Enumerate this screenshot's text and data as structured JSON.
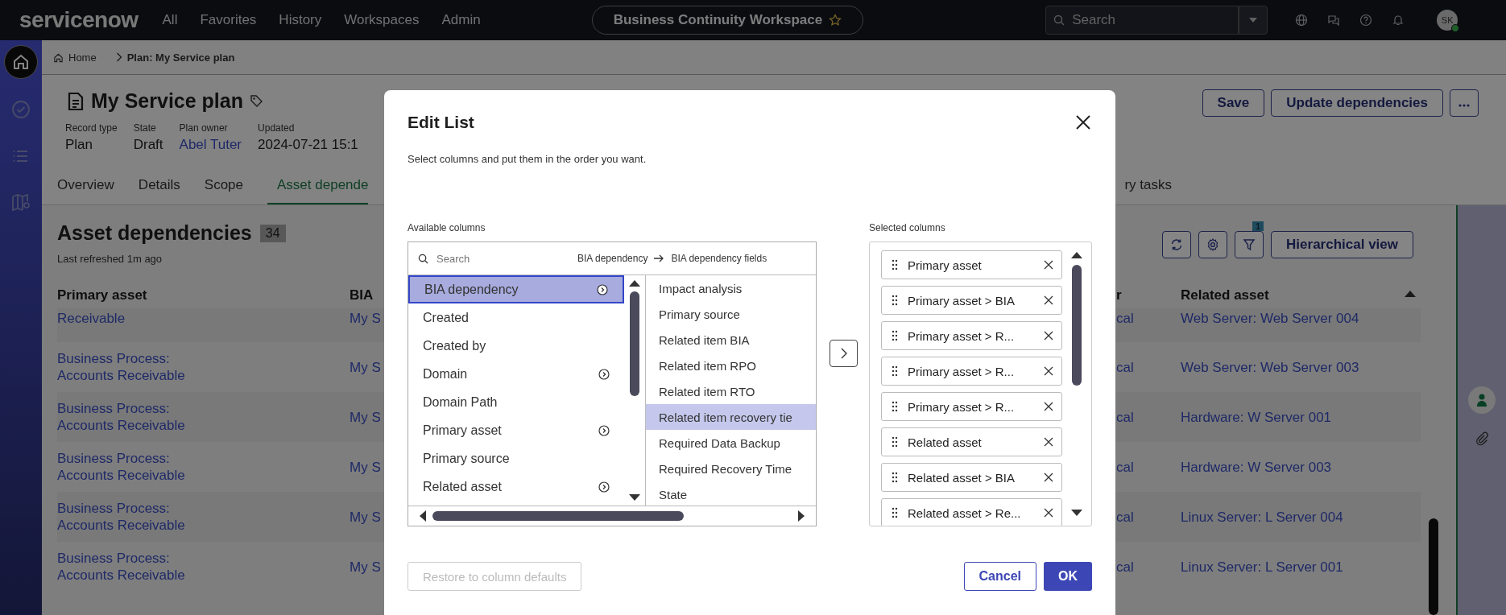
{
  "top_bar": {
    "logo": "servicenow",
    "nav": [
      "All",
      "Favorites",
      "History",
      "Workspaces",
      "Admin"
    ],
    "workspace": "Business Continuity Workspace",
    "search": {
      "placeholder": "Search"
    },
    "avatar": "SK"
  },
  "rail": [
    {
      "kind": "home",
      "selected": true
    },
    {
      "kind": "check",
      "selected": false
    },
    {
      "kind": "list",
      "selected": false
    },
    {
      "kind": "map",
      "selected": false
    }
  ],
  "breadcrumb": [
    "Home",
    "Plan: My Service plan"
  ],
  "record": {
    "title": "My Service plan",
    "fields": [
      {
        "label": "Record type",
        "value": "Plan",
        "link": false
      },
      {
        "label": "State",
        "value": "Draft",
        "link": false
      },
      {
        "label": "Plan owner",
        "value": "Abel Tuter",
        "link": true
      },
      {
        "label": "Updated",
        "value": "2024-07-21 15:1",
        "link": false
      }
    ],
    "buttons": [
      "Save",
      "Update dependencies"
    ]
  },
  "tabs": [
    {
      "label": "Overview",
      "selected": false
    },
    {
      "label": "Details",
      "selected": false
    },
    {
      "label": "Scope",
      "selected": false
    },
    {
      "label": "Asset depende",
      "selected": true
    },
    {
      "label": "ry tasks",
      "selected": false
    }
  ],
  "section": {
    "title": "Asset dependencies",
    "count": "34",
    "refreshed": "Last refreshed 1m ago",
    "filter_count": "1",
    "view_button": "Hierarchical view"
  },
  "table": {
    "columns": [
      "Primary asset",
      "BIA",
      "r",
      "Related asset"
    ],
    "rows": [
      [
        "Receivable",
        "My S",
        "cal",
        "Web Server: Web Server 004"
      ],
      [
        "Business Process: Accounts Receivable",
        "My S",
        "cal",
        "Web Server: Web Server 003"
      ],
      [
        "Business Process: Accounts Receivable",
        "My S",
        "cal",
        "Hardware: W Server 001"
      ],
      [
        "Business Process: Accounts Receivable",
        "My S",
        "cal",
        "Hardware: W Server 003"
      ],
      [
        "Business Process: Accounts Receivable",
        "My S",
        "cal",
        "Linux Server: L Server 004"
      ],
      [
        "Business Process: Accounts Receivable",
        "My S",
        "cal",
        "Linux Server: L Server 001"
      ]
    ]
  },
  "modal": {
    "title": "Edit List",
    "subtitle": "Select columns and put them in the order you want.",
    "available_label": "Available columns",
    "search": {
      "placeholder": "Search"
    },
    "path": [
      "BIA dependency",
      "BIA dependency fields"
    ],
    "available": [
      {
        "label": "BIA dependency",
        "has_children": true,
        "selected": true
      },
      {
        "label": "Created",
        "has_children": false,
        "selected": false
      },
      {
        "label": "Created by",
        "has_children": false,
        "selected": false
      },
      {
        "label": "Domain",
        "has_children": true,
        "selected": false
      },
      {
        "label": "Domain Path",
        "has_children": false,
        "selected": false
      },
      {
        "label": "Primary asset",
        "has_children": true,
        "selected": false
      },
      {
        "label": "Primary source",
        "has_children": false,
        "selected": false
      },
      {
        "label": "Related asset",
        "has_children": true,
        "selected": false
      }
    ],
    "fields": [
      {
        "label": "Impact analysis",
        "selected": false
      },
      {
        "label": "Primary source",
        "selected": false
      },
      {
        "label": "Related item BIA",
        "selected": false
      },
      {
        "label": "Related item RPO",
        "selected": false
      },
      {
        "label": "Related item RTO",
        "selected": false
      },
      {
        "label": "Related item recovery tie",
        "selected": true
      },
      {
        "label": "Required Data Backup",
        "selected": false
      },
      {
        "label": "Required Recovery Time",
        "selected": false
      },
      {
        "label": "State",
        "selected": false
      }
    ],
    "selected_label": "Selected columns",
    "selected": [
      "Primary asset",
      "Primary asset > BIA",
      "Primary asset > R...",
      "Primary asset > R...",
      "Primary asset > R...",
      "Related asset",
      "Related asset > BIA",
      "Related asset > Re..."
    ],
    "restore_button": "Restore to column defaults",
    "cancel_button": "Cancel",
    "ok_button": "OK"
  }
}
